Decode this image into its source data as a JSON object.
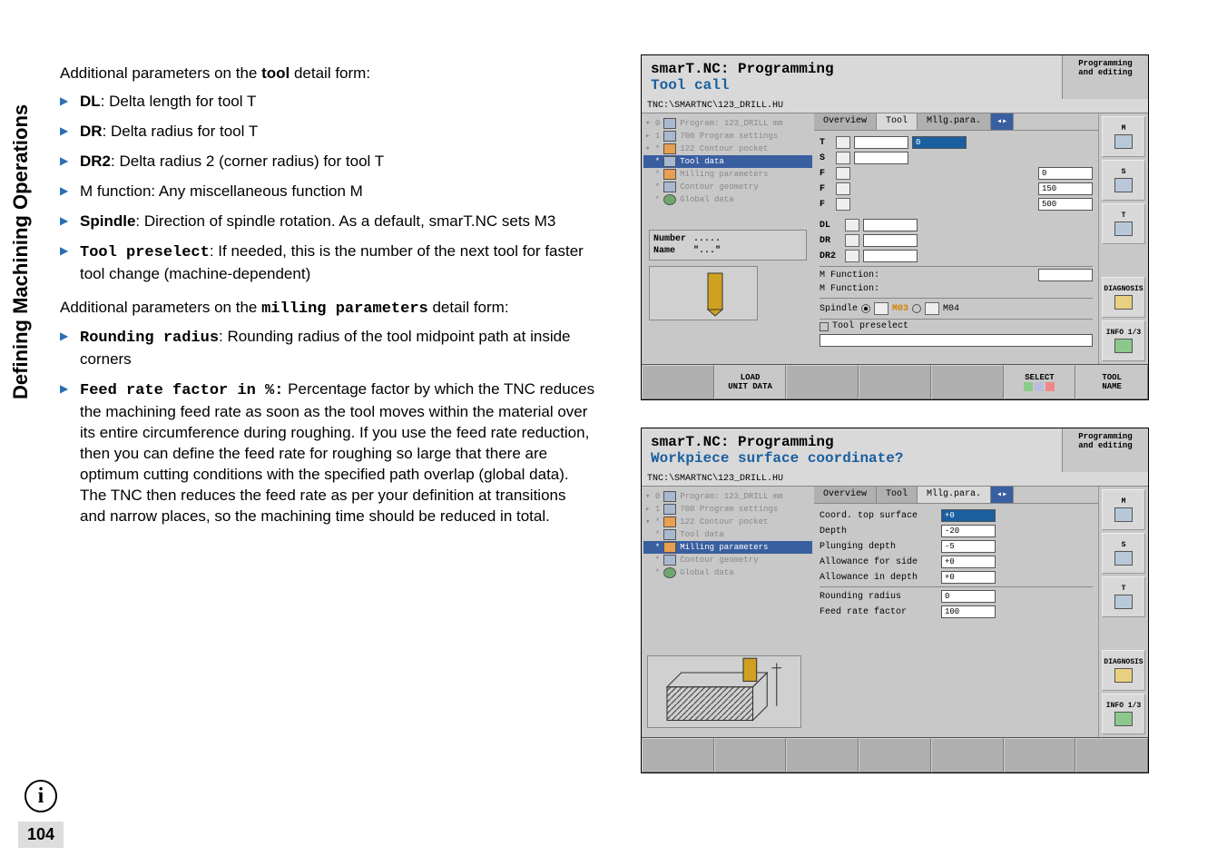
{
  "side_heading": "Defining Machining Operations",
  "intro1_prefix": "Additional parameters on the ",
  "intro1_tool": "tool",
  "intro1_suffix": " detail form:",
  "list1": {
    "dl_b": "DL",
    "dl_t": ": Delta length for tool T",
    "dr_b": "DR",
    "dr_t": ": Delta radius for tool T",
    "dr2_b": "DR2",
    "dr2_t": ": Delta radius 2 (corner radius) for tool T",
    "m_t": "M function: Any miscellaneous function M",
    "sp_b": "Spindle",
    "sp_t": ": Direction of spindle rotation. As a default, smarT.NC sets M3",
    "tp_b": "Tool preselect",
    "tp_t": ": If needed, this is the number of the next tool for faster tool change (machine-dependent)"
  },
  "intro2_prefix": "Additional parameters on the ",
  "intro2_mill": "milling parameters",
  "intro2_suffix": " detail form:",
  "list2": {
    "rr_b": "Rounding radius",
    "rr_t": ": Rounding radius of the tool midpoint path at inside corners",
    "ff_b": "Feed rate factor in %:",
    "ff_t": " Percentage factor by which the TNC reduces the machining feed rate as soon as the tool moves within the material over its entire circumference during roughing. If you use the feed rate reduction, then you can define the feed rate for roughing so large that there are optimum cutting conditions with the specified path overlap (global data). The TNC then reduces the feed rate as per your definition at transitions and narrow places, so the machining time should be reduced in total."
  },
  "ss1": {
    "title_l1": "smarT.NC: Programming",
    "title_l2": "Tool call",
    "mode_l1": "Programming",
    "mode_l2": "and editing",
    "path": "TNC:\\SMARTNC\\123_DRILL.HU",
    "tree": {
      "t0": "Program: 123_DRILL mm",
      "t1": "700 Program settings",
      "t2": "122 Contour pocket",
      "t3": "Tool data",
      "t4": "Milling parameters",
      "t5": "Contour geometry",
      "t6": "Global data"
    },
    "tabs": {
      "overview": "Overview",
      "tool": "Tool",
      "mlg": "Mllg.para."
    },
    "form": {
      "T": "T",
      "S": "S",
      "F1": "F",
      "F2": "F",
      "F3": "F",
      "DL": "DL",
      "DR": "DR",
      "DR2": "DR2",
      "v_t": "",
      "v_t2": "0",
      "v_f1": "0",
      "v_f2": "150",
      "v_f3": "500",
      "mfunc1": "M Function:",
      "mfunc2": "M Function:",
      "spindle": "Spindle",
      "m03": "M03",
      "m04": "M04",
      "tool_presel": "Tool preselect"
    },
    "small": {
      "number": "Number",
      "number_v": ".....",
      "name": "Name",
      "name_v": "\"...\""
    },
    "iconcol": {
      "m": "M",
      "s": "S",
      "t": "T",
      "diag": "DIAGNOSIS",
      "info": "INFO 1/3"
    },
    "sk": {
      "load1": "LOAD",
      "load2": "UNIT DATA",
      "select": "SELECT",
      "toolname1": "TOOL",
      "toolname2": "NAME"
    }
  },
  "ss2": {
    "title_l1": "smarT.NC: Programming",
    "title_l2": "Workpiece surface coordinate?",
    "mode_l1": "Programming",
    "mode_l2": "and editing",
    "path": "TNC:\\SMARTNC\\123_DRILL.HU",
    "tree": {
      "t0": "Program: 123_DRILL mm",
      "t1": "700 Program settings",
      "t2": "122 Contour pocket",
      "t3": "Tool data",
      "t4": "Milling parameters",
      "t5": "Contour geometry",
      "t6": "Global data"
    },
    "tabs": {
      "overview": "Overview",
      "tool": "Tool",
      "mlg": "Mllg.para."
    },
    "form": {
      "r0l": "Coord. top surface",
      "r0v": "+0",
      "r1l": "Depth",
      "r1v": "-20",
      "r2l": "Plunging depth",
      "r2v": "-5",
      "r3l": "Allowance for side",
      "r3v": "+0",
      "r4l": "Allowance in depth",
      "r4v": "+0",
      "r5l": "Rounding radius",
      "r5v": "0",
      "r6l": "Feed rate factor",
      "r6v": "100"
    },
    "iconcol": {
      "m": "M",
      "s": "S",
      "t": "T",
      "diag": "DIAGNOSIS",
      "info": "INFO 1/3"
    }
  },
  "page_number": "104"
}
